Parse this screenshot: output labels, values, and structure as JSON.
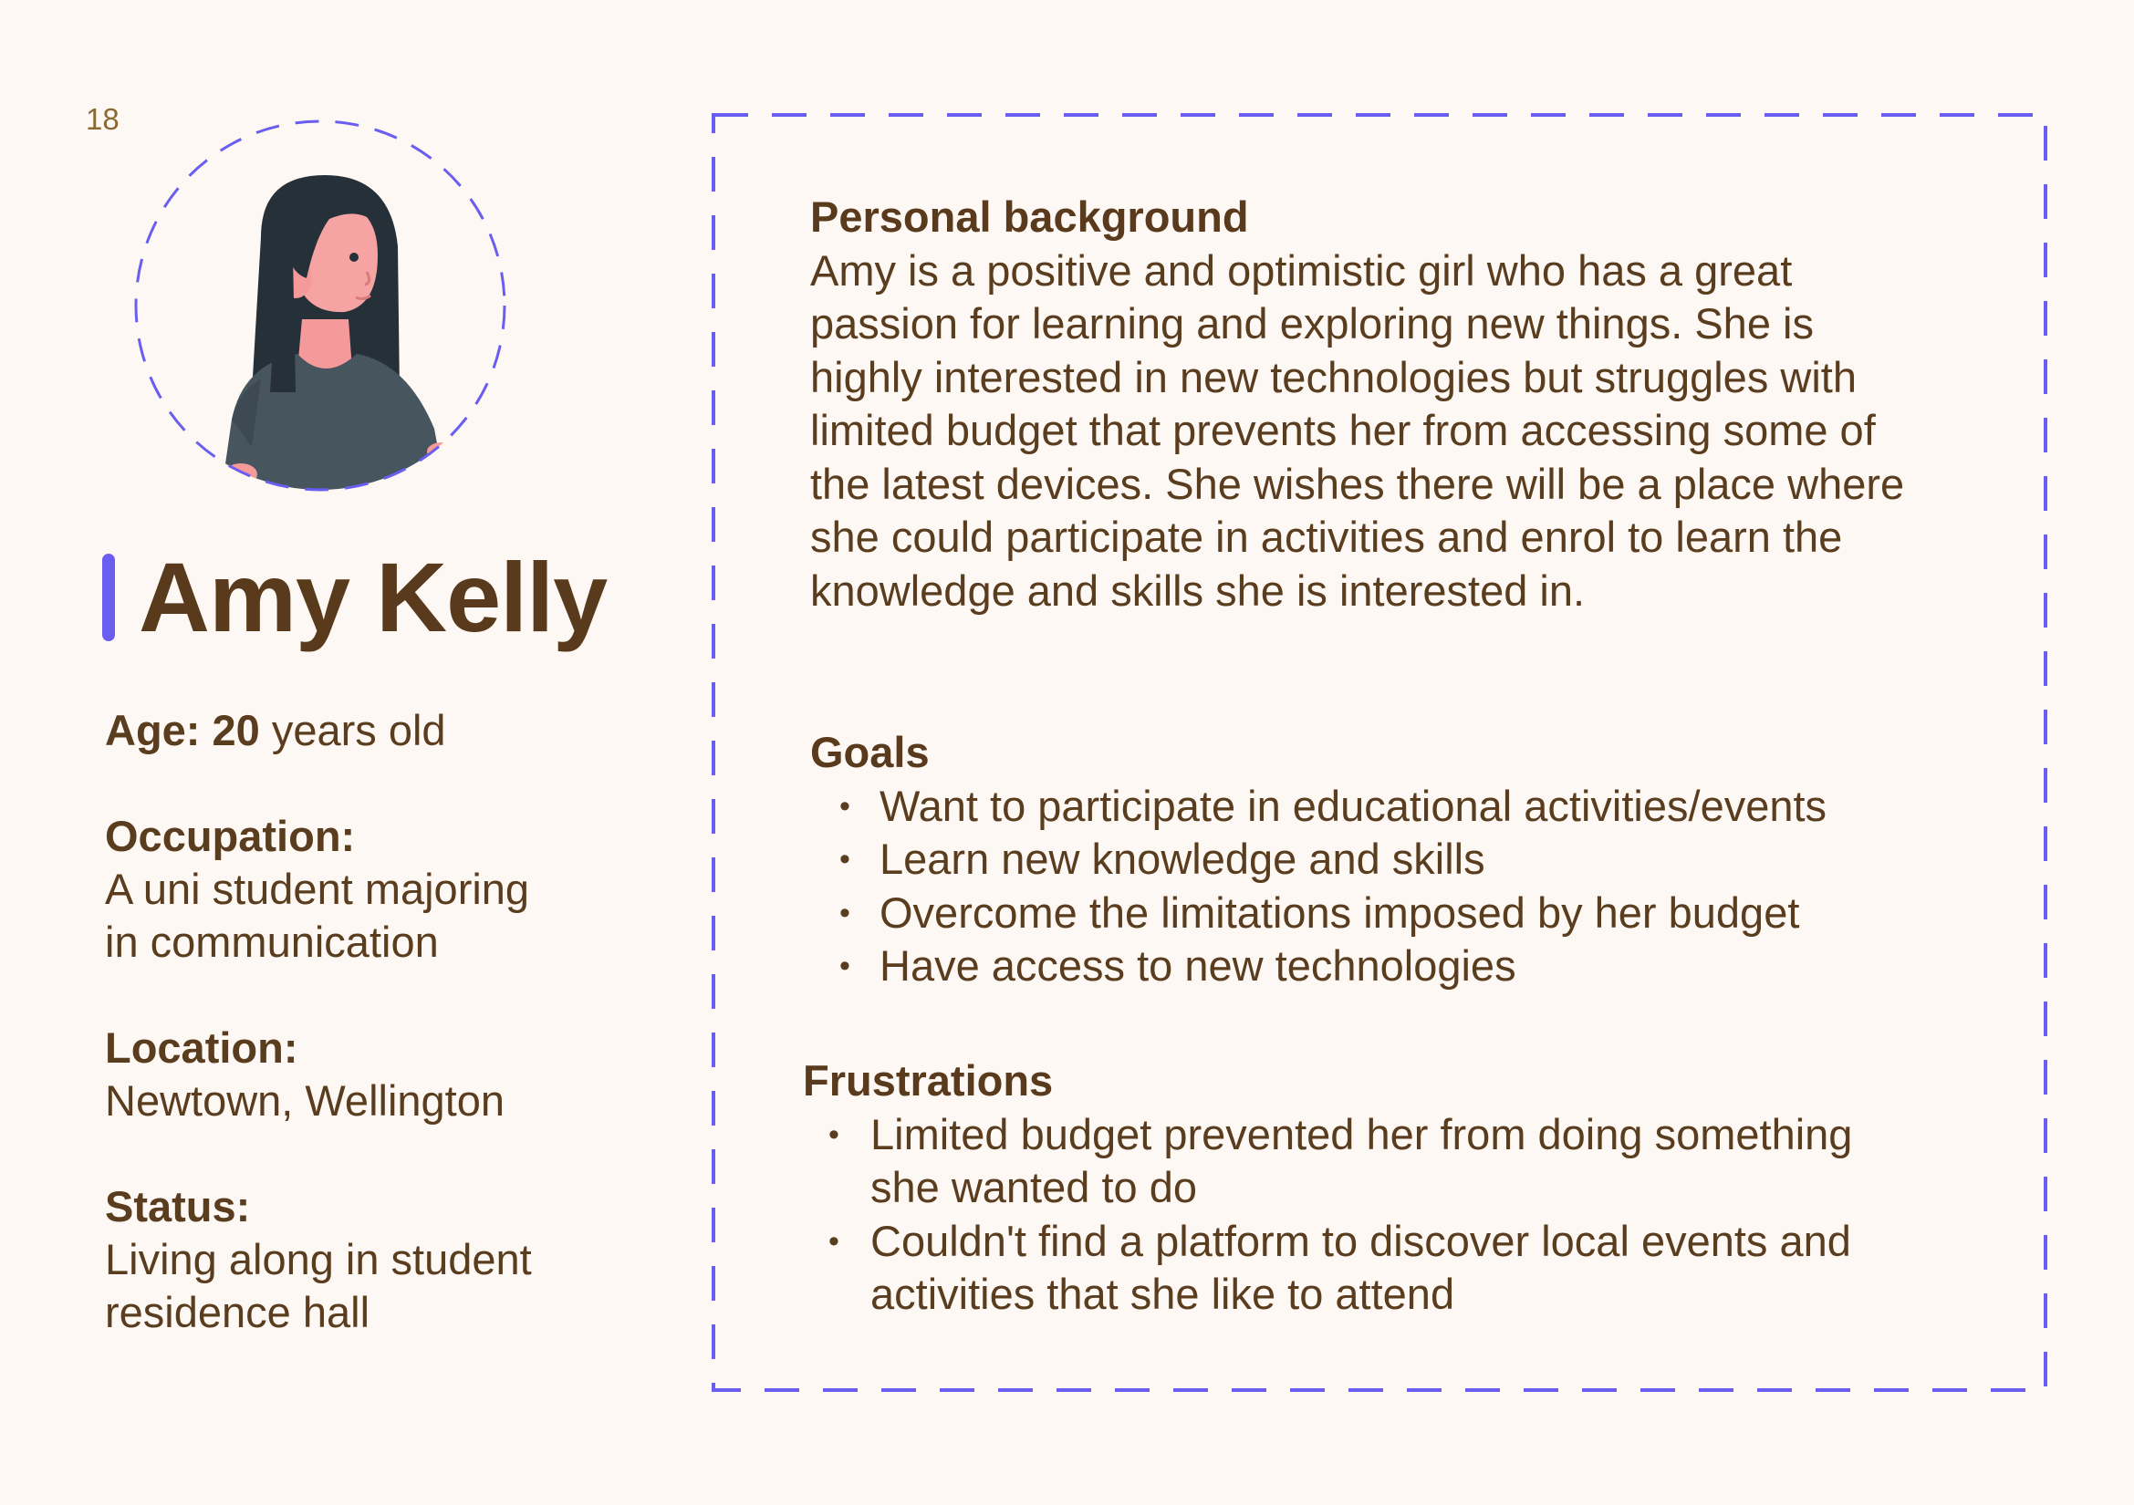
{
  "page_number": "18",
  "persona": {
    "name": "Amy Kelly",
    "avatar_icon": "woman-avatar-icon"
  },
  "facts": {
    "age": {
      "label": "Age:",
      "number": "20",
      "unit": " years old"
    },
    "occupation": {
      "label": "Occupation:",
      "lines": [
        "A uni student majoring",
        "in communication"
      ]
    },
    "location": {
      "label": "Location:",
      "value": "Newtown, Wellington"
    },
    "status": {
      "label": "Status:",
      "lines": [
        "Living along in student",
        "residence hall"
      ]
    }
  },
  "background": {
    "title": "Personal background",
    "lines": [
      "Amy is a positive and optimistic girl who has a great",
      "passion for learning and exploring new things. She is",
      "highly interested in new technologies but struggles with",
      "limited budget that prevents her from accessing some of",
      "the latest devices. She wishes there will be a place where",
      "she could participate in activities and enrol to learn the",
      "knowledge and skills she is interested in."
    ]
  },
  "goals": {
    "title": "Goals",
    "items": [
      "Want to participate in educational activities/events",
      "Learn new knowledge and skills",
      "Overcome the limitations imposed by her budget",
      "Have access to new technologies"
    ]
  },
  "frustrations": {
    "title": "Frustrations",
    "items": [
      {
        "lines": [
          "Limited budget prevented her from doing something",
          "she wanted to do"
        ]
      },
      {
        "lines": [
          "Couldn't find a platform to discover local events and",
          "activities that she like to attend"
        ]
      }
    ]
  },
  "colors": {
    "background": "#fdf8f3",
    "text": "#5a3c1e",
    "accent": "#6a5ef0"
  }
}
